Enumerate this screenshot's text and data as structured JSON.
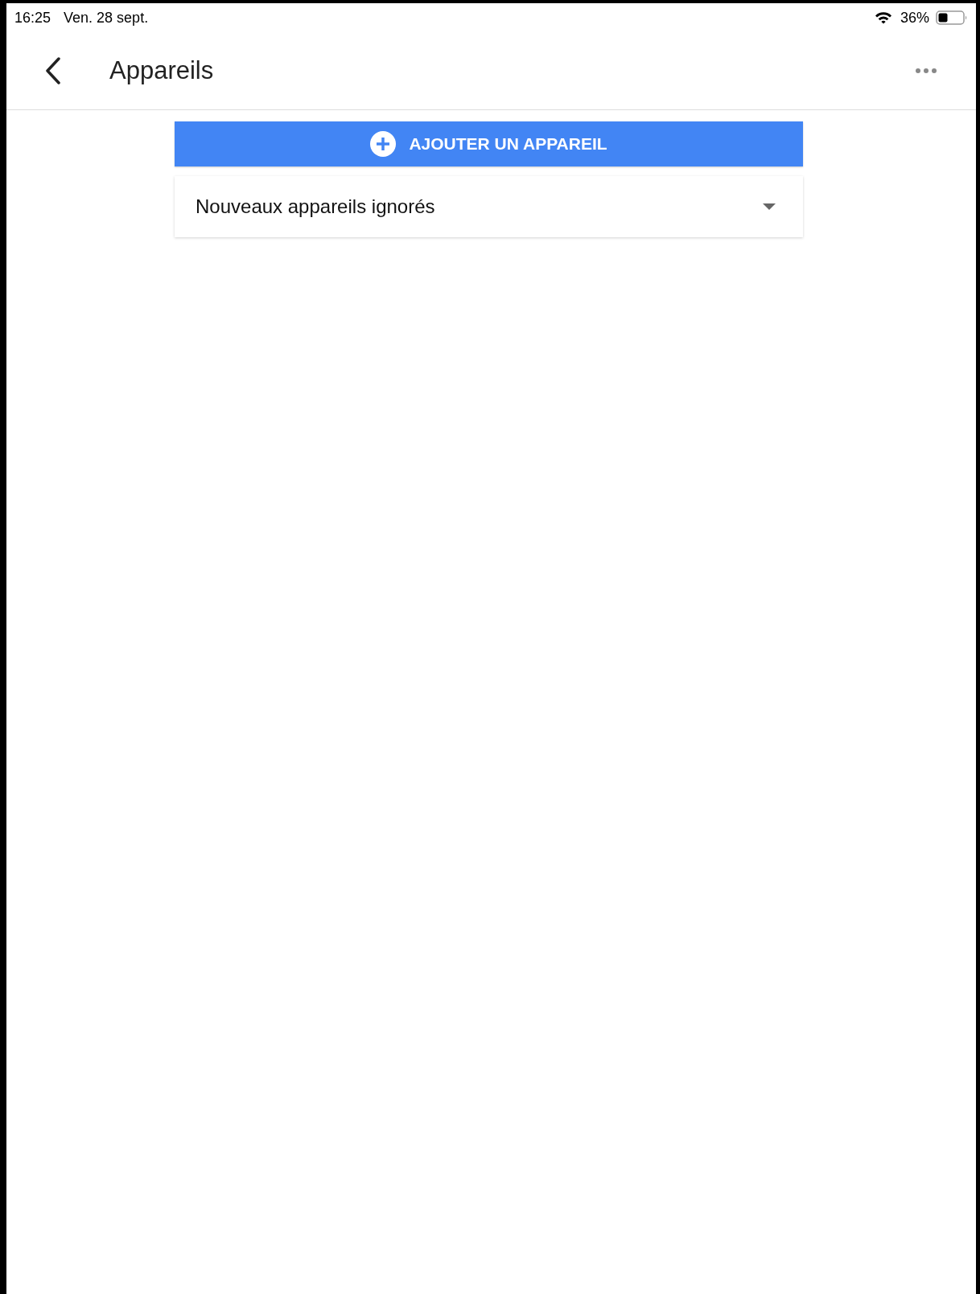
{
  "status_bar": {
    "time": "16:25",
    "date": "Ven. 28 sept.",
    "battery": "36%"
  },
  "header": {
    "title": "Appareils"
  },
  "add_button": {
    "label": "AJOUTER UN APPAREIL"
  },
  "sections": [
    {
      "label": "Nouveaux appareils ignorés",
      "expanded": false
    }
  ]
}
